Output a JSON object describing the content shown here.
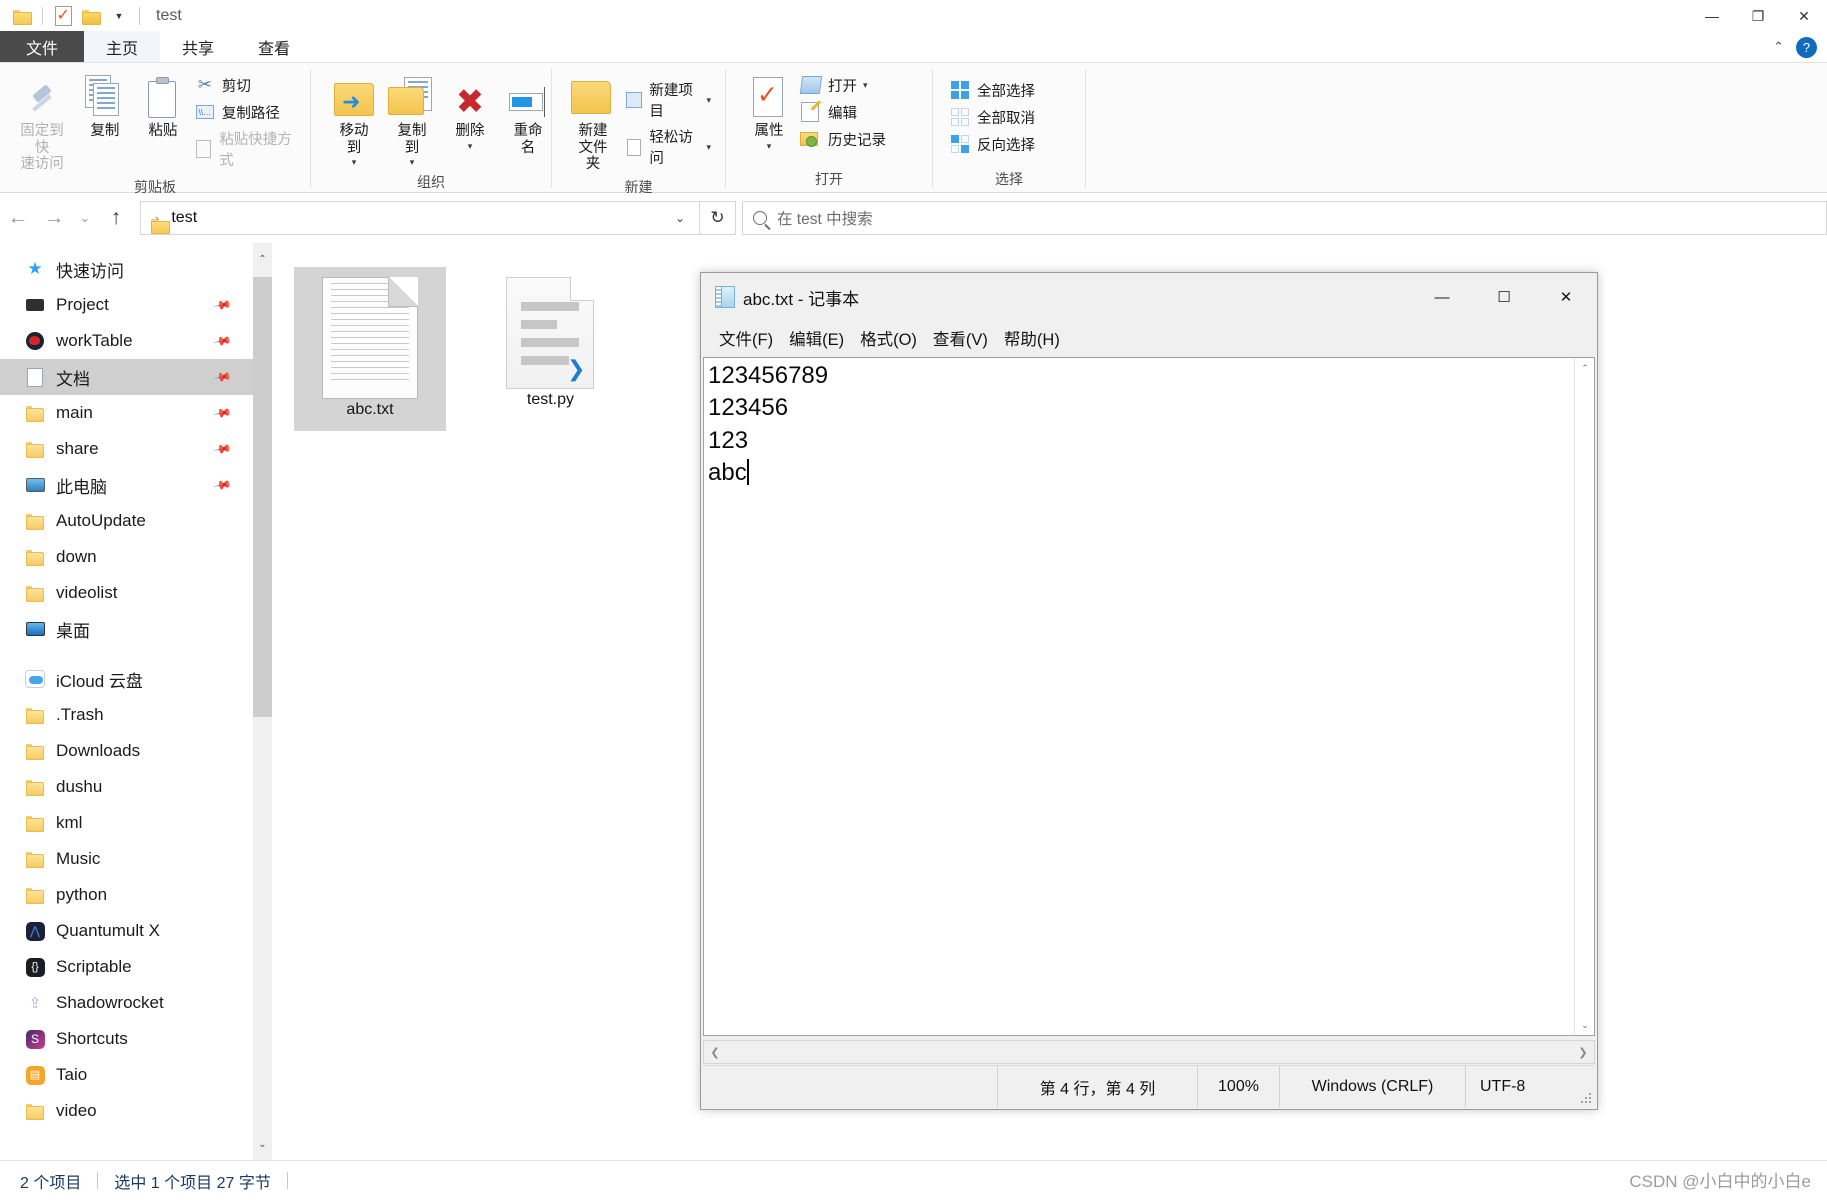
{
  "explorer": {
    "title": "test",
    "quick_access_icons": [
      "folder-icon",
      "properties-check-icon",
      "new-folder-icon",
      "customize-caret-icon"
    ],
    "window_buttons": {
      "minimize": "—",
      "restore": "❐",
      "close": "✕"
    },
    "tabs": [
      {
        "label": "文件",
        "id": "file"
      },
      {
        "label": "主页",
        "id": "home"
      },
      {
        "label": "共享",
        "id": "share"
      },
      {
        "label": "查看",
        "id": "view"
      }
    ],
    "active_tab": "主页",
    "ribbon_collapse": "⌃",
    "ribbon_help": "?",
    "ribbon": {
      "groups": [
        {
          "label": "剪贴板",
          "big": [
            {
              "label_line1": "固定到快",
              "label_line2": "速访问",
              "icon": "pin-icon",
              "dim": true
            },
            {
              "label_line1": "复制",
              "label_line2": "",
              "icon": "copy-icon",
              "dim": false
            },
            {
              "label_line1": "粘贴",
              "label_line2": "",
              "icon": "paste-icon",
              "dim": false
            }
          ],
          "small": [
            {
              "label": "剪切",
              "icon": "scissors-icon",
              "dim": false
            },
            {
              "label": "复制路径",
              "icon": "copy-path-icon",
              "dim": false
            },
            {
              "label": "粘贴快捷方式",
              "icon": "paste-shortcut-icon",
              "dim": true
            }
          ]
        },
        {
          "label": "组织",
          "big": [
            {
              "label_line1": "移动到",
              "label_line2": "",
              "icon": "move-to-icon",
              "caret": true
            },
            {
              "label_line1": "复制到",
              "label_line2": "",
              "icon": "copy-to-icon",
              "caret": true
            },
            {
              "label_line1": "删除",
              "label_line2": "",
              "icon": "delete-icon",
              "caret": true
            },
            {
              "label_line1": "重命名",
              "label_line2": "",
              "icon": "rename-icon",
              "caret": false
            }
          ],
          "small": []
        },
        {
          "label": "新建",
          "big": [
            {
              "label_line1": "新建",
              "label_line2": "文件夹",
              "icon": "new-folder-icon",
              "caret": false
            }
          ],
          "small": [
            {
              "label": "新建项目",
              "icon": "new-item-icon",
              "caret": true
            },
            {
              "label": "轻松访问",
              "icon": "easy-access-icon",
              "caret": true
            }
          ]
        },
        {
          "label": "打开",
          "big": [
            {
              "label_line1": "属性",
              "label_line2": "",
              "icon": "properties-icon",
              "caret": true
            }
          ],
          "small": [
            {
              "label": "打开",
              "icon": "open-icon",
              "caret": true
            },
            {
              "label": "编辑",
              "icon": "edit-icon",
              "caret": false
            },
            {
              "label": "历史记录",
              "icon": "history-icon",
              "caret": false
            }
          ]
        },
        {
          "label": "选择",
          "big": [],
          "small": [
            {
              "label": "全部选择",
              "icon": "select-all-icon"
            },
            {
              "label": "全部取消",
              "icon": "select-none-icon"
            },
            {
              "label": "反向选择",
              "icon": "invert-selection-icon"
            }
          ]
        }
      ]
    },
    "nav": {
      "back": "←",
      "forward": "→",
      "recent": "⌄",
      "up": "↑",
      "breadcrumb_root_icon": "folder-icon",
      "breadcrumb": [
        "test"
      ],
      "breadcrumb_sep": "›",
      "dropdown_caret": "⌄",
      "refresh_icon": "↻",
      "search_placeholder": "在 test 中搜索"
    },
    "sidebar": {
      "items": [
        {
          "label": "快速访问",
          "icon": "star-icon",
          "indent": 0,
          "pinned": false,
          "selected": false
        },
        {
          "label": "Project",
          "icon": "chip-icon",
          "indent": 1,
          "pinned": true,
          "selected": false
        },
        {
          "label": "workTable",
          "icon": "worktable-icon",
          "indent": 1,
          "pinned": true,
          "selected": false
        },
        {
          "label": "文档",
          "icon": "documents-icon",
          "indent": 1,
          "pinned": true,
          "selected": true
        },
        {
          "label": "main",
          "icon": "folder-icon",
          "indent": 1,
          "pinned": true,
          "selected": false
        },
        {
          "label": "share",
          "icon": "shared-folder-icon",
          "indent": 1,
          "pinned": true,
          "selected": false
        },
        {
          "label": "此电脑",
          "icon": "this-pc-icon",
          "indent": 1,
          "pinned": true,
          "selected": false
        },
        {
          "label": "AutoUpdate",
          "icon": "folder-icon",
          "indent": 1,
          "pinned": false,
          "selected": false
        },
        {
          "label": "down",
          "icon": "folder-icon",
          "indent": 1,
          "pinned": false,
          "selected": false
        },
        {
          "label": "videolist",
          "icon": "folder-icon",
          "indent": 1,
          "pinned": false,
          "selected": false
        },
        {
          "label": "桌面",
          "icon": "desktop-icon",
          "indent": 1,
          "pinned": false,
          "selected": false
        },
        {
          "label": "iCloud 云盘",
          "icon": "icloud-icon",
          "indent": 0,
          "pinned": false,
          "selected": false,
          "gap_before": true
        },
        {
          "label": ".Trash",
          "icon": "folder-icon",
          "indent": 1,
          "pinned": false,
          "selected": false
        },
        {
          "label": "Downloads",
          "icon": "folder-icon",
          "indent": 1,
          "pinned": false,
          "selected": false
        },
        {
          "label": "dushu",
          "icon": "folder-icon",
          "indent": 1,
          "pinned": false,
          "selected": false
        },
        {
          "label": "kml",
          "icon": "folder-icon",
          "indent": 1,
          "pinned": false,
          "selected": false
        },
        {
          "label": "Music",
          "icon": "folder-icon",
          "indent": 1,
          "pinned": false,
          "selected": false
        },
        {
          "label": "python",
          "icon": "folder-icon",
          "indent": 1,
          "pinned": false,
          "selected": false
        },
        {
          "label": "Quantumult X",
          "icon": "quantumult-icon",
          "indent": 1,
          "pinned": false,
          "selected": false
        },
        {
          "label": "Scriptable",
          "icon": "scriptable-icon",
          "indent": 1,
          "pinned": false,
          "selected": false
        },
        {
          "label": "Shadowrocket",
          "icon": "shadowrocket-icon",
          "indent": 1,
          "pinned": false,
          "selected": false
        },
        {
          "label": "Shortcuts",
          "icon": "shortcuts-icon",
          "indent": 1,
          "pinned": false,
          "selected": false
        },
        {
          "label": "Taio",
          "icon": "taio-icon",
          "indent": 1,
          "pinned": false,
          "selected": false
        },
        {
          "label": "video",
          "icon": "folder-icon",
          "indent": 1,
          "pinned": false,
          "selected": false
        }
      ],
      "scroll_up_icon": "⌃",
      "scroll_down_icon": "⌄"
    },
    "files": [
      {
        "name": "abc.txt",
        "type": "text",
        "selected": true
      },
      {
        "name": "test.py",
        "type": "python",
        "selected": false
      }
    ],
    "status": {
      "item_count": "2 个项目",
      "selection": "选中 1 个项目  27 字节"
    },
    "watermark": "CSDN @小白中的小白e"
  },
  "notepad": {
    "title": "abc.txt - 记事本",
    "icon": "notepad-icon",
    "window_buttons": {
      "minimize": "—",
      "maximize": "☐",
      "close": "✕"
    },
    "menus": [
      "文件(F)",
      "编辑(E)",
      "格式(O)",
      "查看(V)",
      "帮助(H)"
    ],
    "content": "123456789\n123456\n123\nabc",
    "status": {
      "position": "第 4 行，第 4 列",
      "zoom": "100%",
      "line_ending": "Windows (CRLF)",
      "encoding": "UTF-8"
    },
    "hscroll_left": "❮",
    "hscroll_right": "❯",
    "vscroll_up": "⌃",
    "vscroll_down": "⌄"
  }
}
